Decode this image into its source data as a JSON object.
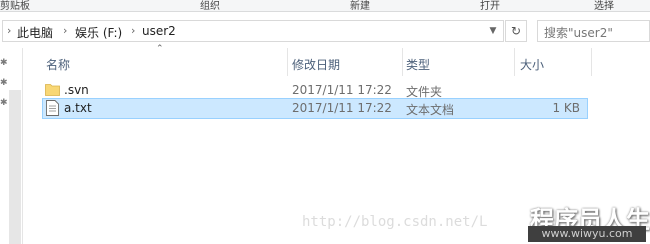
{
  "ribbon": {
    "groups": [
      "剪贴板",
      "组织",
      "新建",
      "打开",
      "选择"
    ]
  },
  "address": {
    "segments": [
      "此电脑",
      "娱乐 (F:)",
      "user2"
    ],
    "separator": "›"
  },
  "search": {
    "placeholder": "搜索\"user2\""
  },
  "columns": {
    "name": "名称",
    "date": "修改日期",
    "type": "类型",
    "size": "大小"
  },
  "files": [
    {
      "name": ".svn",
      "date": "2017/1/11 17:22",
      "type": "文件夹",
      "size": "",
      "icon": "folder-icon",
      "selected": false
    },
    {
      "name": "a.txt",
      "date": "2017/1/11 17:22",
      "type": "文本文档",
      "size": "1 KB",
      "icon": "text-file-icon",
      "selected": true
    }
  ],
  "watermark": {
    "text": "http://blog.csdn.net/L"
  },
  "brand": {
    "name": "程序员人生",
    "url": "www.wiwyu.com"
  },
  "colors": {
    "selection_bg": "#cce8ff",
    "selection_border": "#99d1ff",
    "header_text": "#4c607a",
    "folder": "#f8d775"
  }
}
